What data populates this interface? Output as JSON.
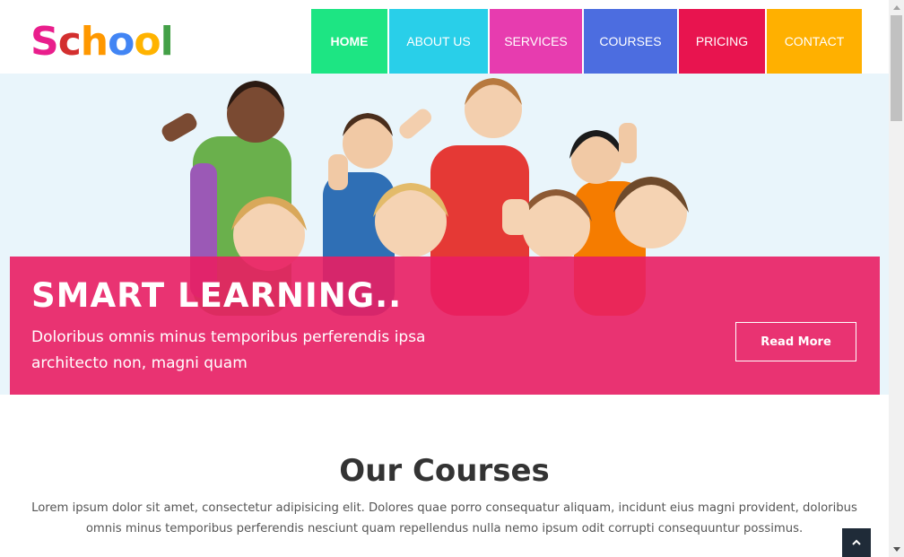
{
  "logo": {
    "letters": [
      "S",
      "c",
      "h",
      "o",
      "o",
      "l"
    ],
    "colors": [
      "#e91e8c",
      "#d32f2f",
      "#ff9800",
      "#4285f4",
      "#ffb300",
      "#43a047"
    ]
  },
  "nav": {
    "items": [
      {
        "label": "HOME",
        "color": "#1de583",
        "active": true
      },
      {
        "label": "ABOUT US",
        "color": "#29cfe9"
      },
      {
        "label": "SERVICES",
        "color": "#e73caf"
      },
      {
        "label": "COURSES",
        "color": "#4c6de0"
      },
      {
        "label": "PRICING",
        "color": "#e8144f"
      },
      {
        "label": "CONTACT",
        "color": "#ffb000"
      }
    ]
  },
  "hero": {
    "title": "SMART LEARNING..",
    "text": "Doloribus omnis minus temporibus perferendis ipsa architecto non, magni quam",
    "button": "Read More",
    "accent": "#e91e63"
  },
  "courses": {
    "title": "Our Courses",
    "text": "Lorem ipsum dolor sit amet, consectetur adipisicing elit. Dolores quae porro consequatur aliquam, incidunt eius magni provident, doloribus omnis minus temporibus perferendis nesciunt quam repellendus nulla nemo ipsum odit corrupti consequuntur possimus."
  },
  "icons": {
    "back_to_top": "chevron-up-icon"
  }
}
